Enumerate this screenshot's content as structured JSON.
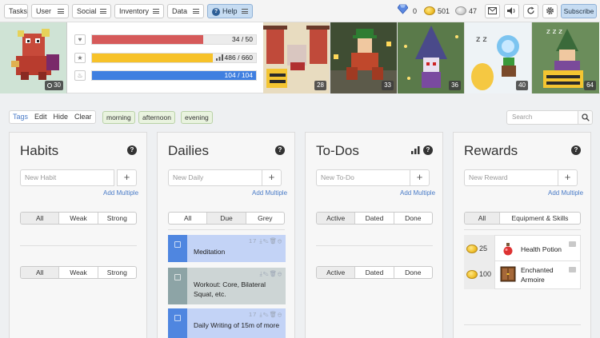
{
  "nav": {
    "tasks": "Tasks",
    "user": "User",
    "social": "Social",
    "inventory": "Inventory",
    "data": "Data",
    "help": "Help",
    "subscribe": "Subscribe"
  },
  "currency": {
    "gems": "0",
    "gold": "501",
    "hourglass": "47"
  },
  "icons": {
    "mail": "envelope-icon",
    "sound": "speaker-icon",
    "sync": "sync-icon",
    "settings": "gear-icon"
  },
  "player": {
    "level": "30",
    "health": "34 / 50",
    "experience": "486 / 660",
    "mana": "104 / 104",
    "health_fraction": 0.68,
    "experience_fraction": 0.736,
    "mana_fraction": 1.0,
    "health_color": "#d65a5a",
    "experience_color": "#f7c229",
    "mana_color": "#3f7fe0"
  },
  "party": [
    {
      "level": "28"
    },
    {
      "level": "33"
    },
    {
      "level": "36"
    },
    {
      "level": "40"
    },
    {
      "level": "64"
    }
  ],
  "filters": {
    "tags": "Tags",
    "edit": "Edit",
    "hide": "Hide",
    "clear": "Clear",
    "chips": [
      "morning",
      "afternoon",
      "evening"
    ],
    "search_placeholder": "Search"
  },
  "habits": {
    "title": "Habits",
    "placeholder": "New Habit",
    "add_multiple": "Add Multiple",
    "filters": [
      "All",
      "Weak",
      "Strong"
    ],
    "filters2": [
      "All",
      "Weak",
      "Strong"
    ]
  },
  "dailies": {
    "title": "Dailies",
    "placeholder": "New Daily",
    "add_multiple": "Add Multiple",
    "filters": [
      "All",
      "Due",
      "Grey"
    ],
    "items": [
      {
        "text": "Meditation",
        "streak": "17"
      },
      {
        "text": "Workout: Core, Bilateral Squat, etc.",
        "streak": ""
      },
      {
        "text": "Daily Writing of 15m of more",
        "streak": "17"
      }
    ]
  },
  "todos": {
    "title": "To-Dos",
    "placeholder": "New To-Do",
    "add_multiple": "Add Multiple",
    "filters": [
      "Active",
      "Dated",
      "Done"
    ],
    "filters2": [
      "Active",
      "Dated",
      "Done"
    ]
  },
  "rewards": {
    "title": "Rewards",
    "placeholder": "New Reward",
    "add_multiple": "Add Multiple",
    "filters": [
      "All",
      "Equipment & Skills"
    ],
    "items": [
      {
        "price": "25",
        "name": "Health Potion"
      },
      {
        "price": "100",
        "name": "Enchanted Armoire"
      }
    ]
  }
}
